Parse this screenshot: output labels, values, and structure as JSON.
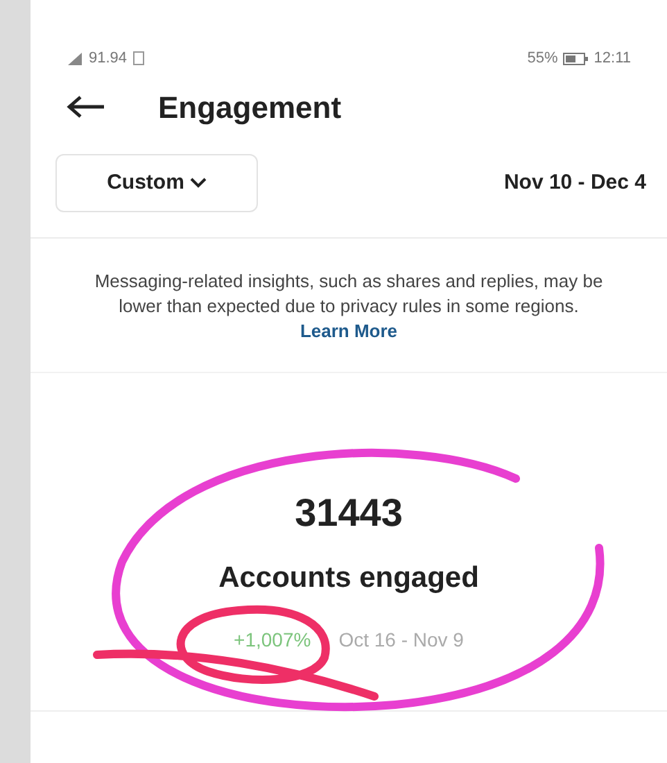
{
  "status_bar": {
    "network_speed": "91.94",
    "battery": "55%",
    "time": "12:11"
  },
  "header": {
    "title": "Engagement"
  },
  "filter": {
    "label": "Custom",
    "date_range": "Nov 10 - Dec 4"
  },
  "notice": {
    "text": "Messaging-related insights, such as shares and replies, may be lower than expected due to privacy rules in some regions.",
    "link": "Learn More"
  },
  "metric": {
    "value": "31443",
    "label": "Accounts engaged",
    "change": "+1,007%",
    "comparison_range": "Oct 16 - Nov 9"
  }
}
